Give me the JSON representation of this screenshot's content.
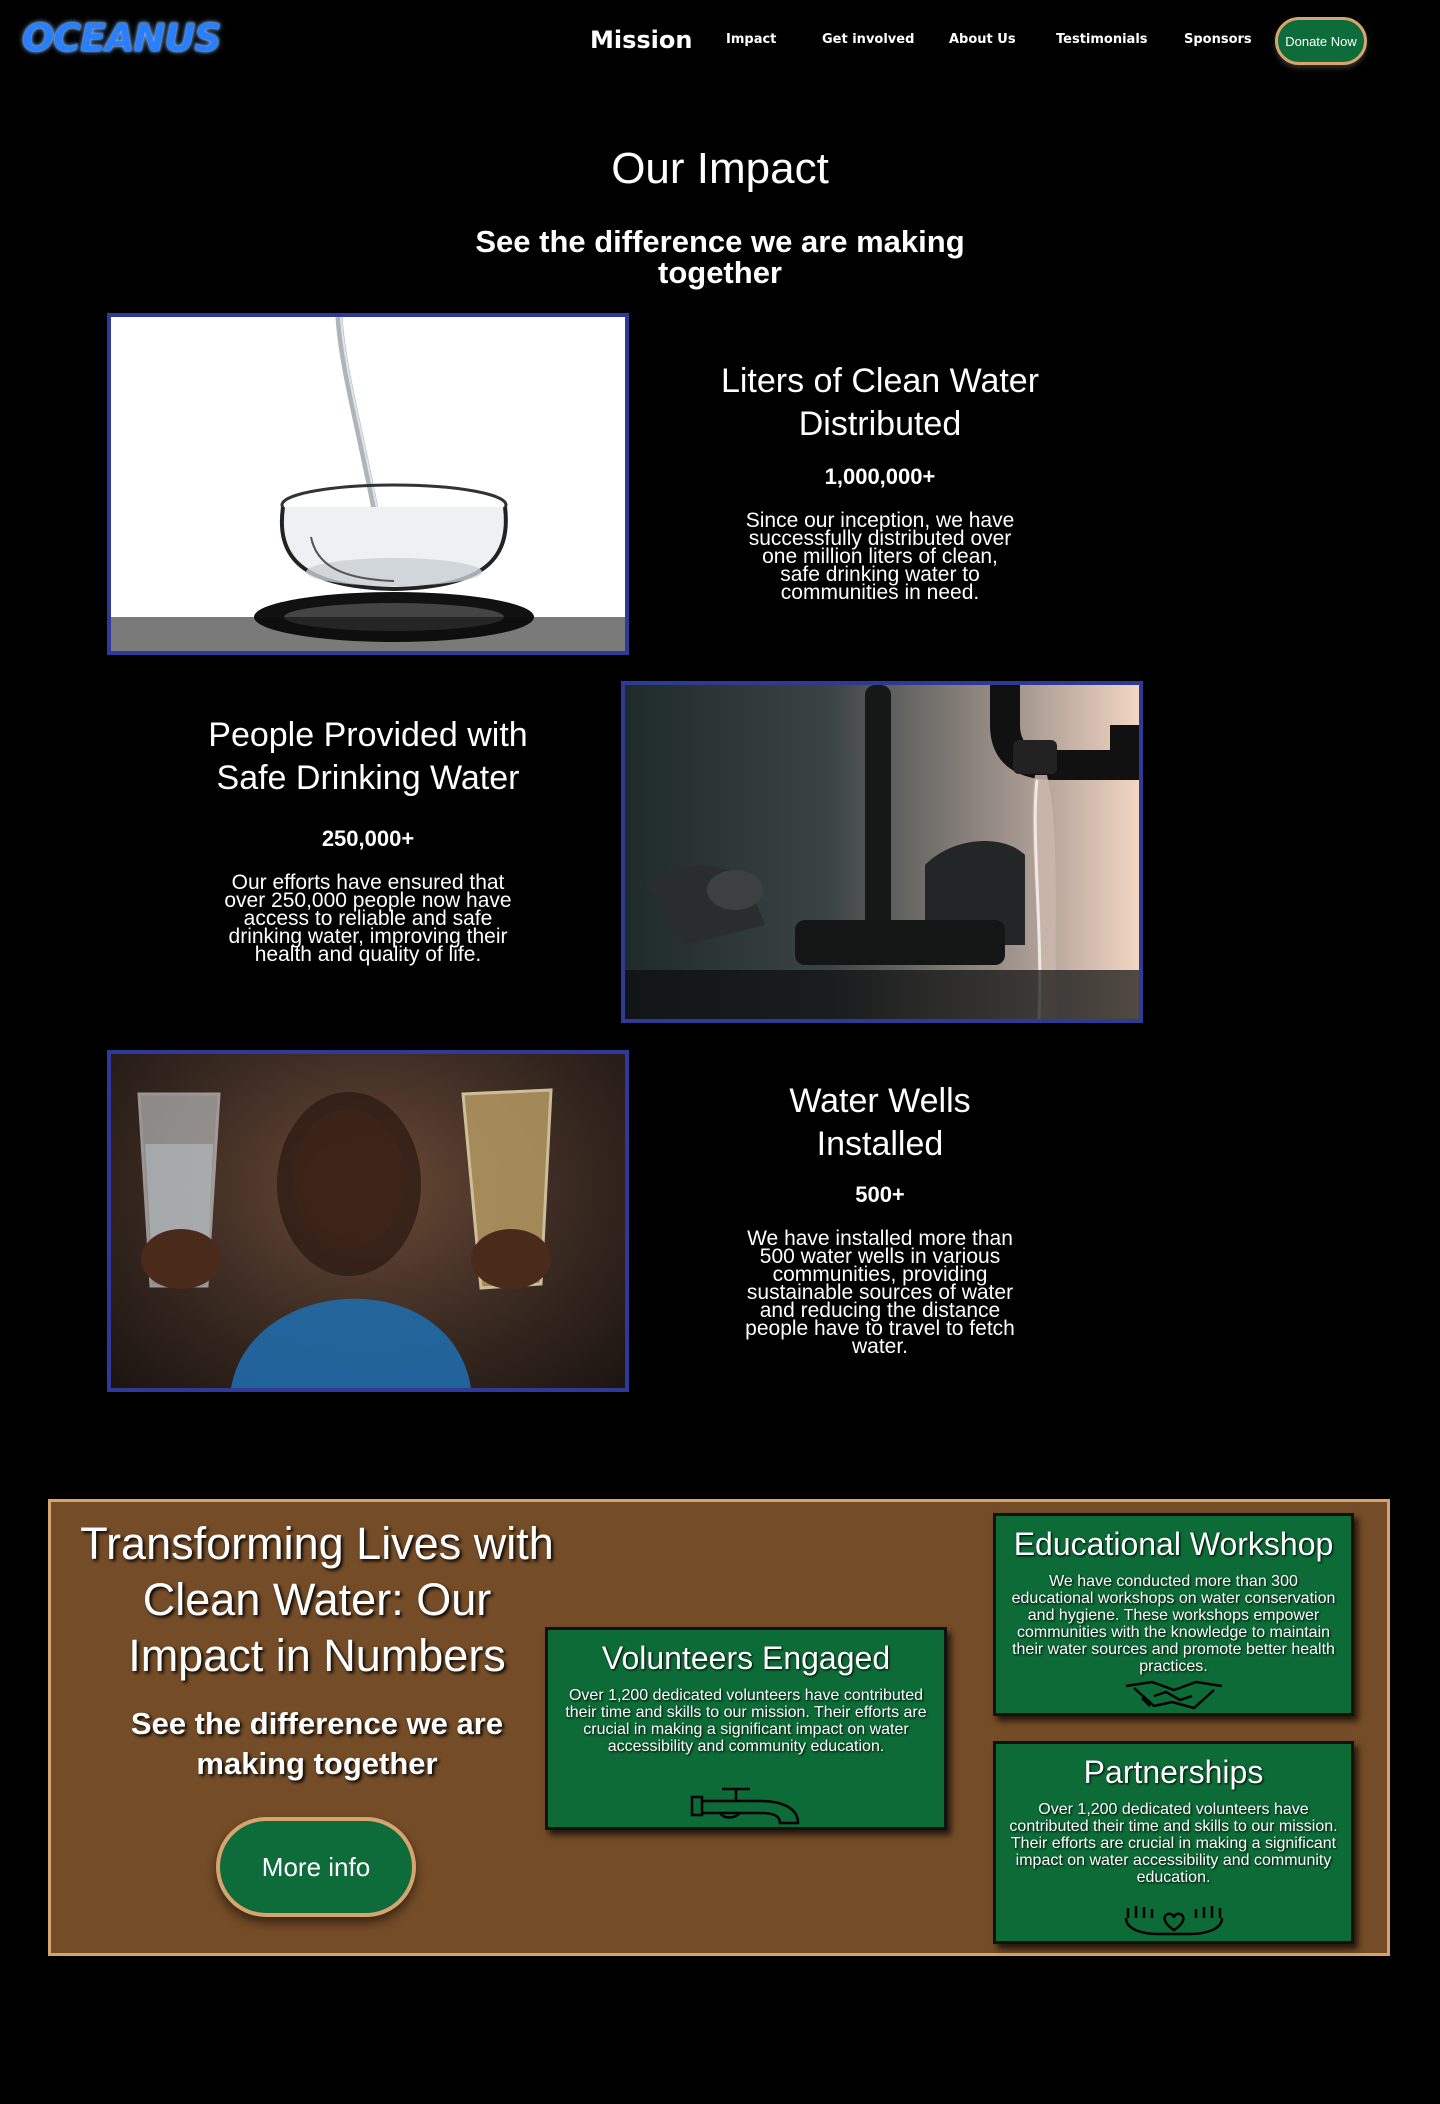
{
  "nav": {
    "logo": "OCEANUS",
    "links": [
      "Mission",
      "Impact",
      "Get involved",
      "About Us",
      "Testimonials",
      "Sponsors"
    ],
    "donate": "Donate Now"
  },
  "impact": {
    "title": "Our Impact",
    "subtitle": "See the difference we are making together",
    "stats": [
      {
        "title": "Liters of Clean Water Distributed",
        "number": "1,000,000+",
        "description": "Since our inception, we have successfully distributed over one million liters of clean, safe drinking water to communities in need."
      },
      {
        "title": "People Provided with Safe Drinking Water",
        "number": "250,000+",
        "description": "Our efforts have ensured that over 250,000 people now have access to reliable and safe drinking water, improving their health and quality of life."
      },
      {
        "title": "Water Wells Installed",
        "number": "500+",
        "description": "We have installed more than 500 water wells in various communities, providing sustainable sources of water and reducing the distance people have to travel to fetch water."
      }
    ]
  },
  "numbers": {
    "title": "Transforming Lives with Clean Water: Our Impact in Numbers",
    "subtitle": "See the difference we are making together",
    "button": "More info",
    "cards": [
      {
        "title": "Volunteers Engaged",
        "description": "Over 1,200 dedicated volunteers have contributed their time and skills to our mission. Their efforts are crucial in making a significant impact on water accessibility and community education.",
        "icon": "faucet-icon"
      },
      {
        "title": "Educational Workshop",
        "description": "We have conducted more than 300 educational workshops on water conservation and hygiene. These workshops empower communities with the knowledge to maintain their water sources and promote better health practices.",
        "icon": "handshake-icon"
      },
      {
        "title": "Partnerships",
        "description": "Over 1,200 dedicated volunteers have contributed their time and skills to our mission. Their efforts are crucial in making a significant impact on water accessibility and community education.",
        "icon": "heart-hands-icon"
      }
    ]
  },
  "colors": {
    "accent_green": "#0e6b3a",
    "brown": "#744c27",
    "tan": "#d6a56f",
    "frame_blue": "#2e3a96",
    "logo_blue": "#2a7fff"
  }
}
